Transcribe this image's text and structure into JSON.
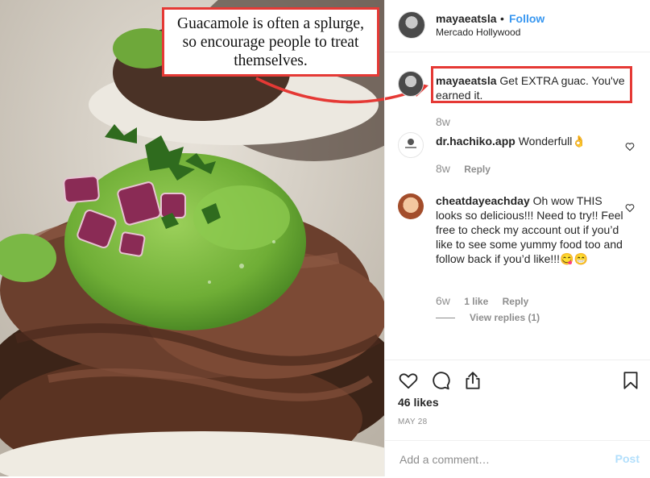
{
  "annotation": {
    "text": "Guacamole is often a splurge, so encourage people to treat themselves."
  },
  "header": {
    "username": "mayaeatsla",
    "dot": "•",
    "follow": "Follow",
    "location": "Mercado Hollywood"
  },
  "comments": [
    {
      "username": "mayaeatsla",
      "text": "Get EXTRA guac. You've earned it.",
      "time": "8w"
    },
    {
      "username": "dr.hachiko.app",
      "text": "Wonderfull👌",
      "time": "8w",
      "reply": "Reply"
    },
    {
      "username": "cheatdayeachday",
      "text": "Oh wow THIS looks so delicious!!! Need to try!! Feel free to check my account out if you’d like to see some yummy food too and follow back if you’d like!!!😋😁",
      "time": "6w",
      "likes": "1 like",
      "reply": "Reply",
      "view_replies": "View replies (1)"
    }
  ],
  "footer": {
    "likes": "46 likes",
    "date": "MAY 28",
    "comment_placeholder": "Add a comment…",
    "post": "Post"
  },
  "icons": [
    "heart-icon",
    "comment-icon",
    "share-icon",
    "bookmark-icon"
  ],
  "colors": {
    "accent": "#3897f0",
    "annotation": "#e53935",
    "post_disabled": "#b2dffc"
  }
}
